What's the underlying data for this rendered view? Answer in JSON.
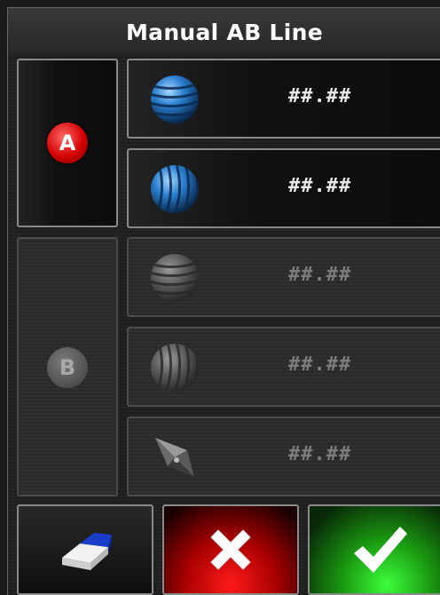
{
  "dialog": {
    "title": "Manual AB Line"
  },
  "point_a": {
    "badge": "A",
    "latitude": "##.##",
    "longitude": "##.##"
  },
  "point_b": {
    "badge": "B",
    "latitude": "##.##",
    "longitude": "##.##",
    "heading": "##.##"
  },
  "buttons": {
    "clear": "eraser-icon",
    "cancel": "cross-icon",
    "accept": "checkmark-icon"
  },
  "colors": {
    "point_a_badge": "#d40000",
    "globe_active": "#2a7fd0",
    "cancel_button": "#c00000",
    "accept_button": "#1a9a10"
  }
}
